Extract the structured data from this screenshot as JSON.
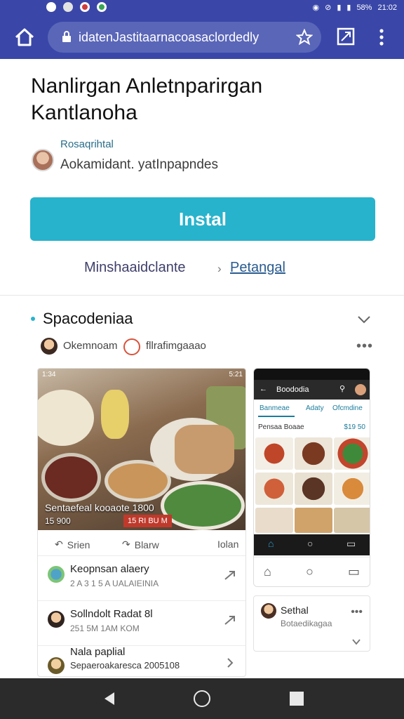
{
  "status_bar": {
    "battery": "58%",
    "time": "21:02"
  },
  "browser": {
    "url": "idatenJastitaarnacoasaclordedly"
  },
  "app": {
    "title": "Nanlirgan Anletnparirgan Kantlanoha",
    "developer_name": "Rosaqrihtal",
    "developer_desc": "Aokamidant. yatInpapndes",
    "install_label": "Instal",
    "more_label": "Minshaaidclante",
    "related_label": "Petangal"
  },
  "section": {
    "title": "Spacodeniaa",
    "author_name": "Okemnoam",
    "category_name": "fllrafimgaaao"
  },
  "left_card": {
    "status_time": "1:34",
    "status_right": "5:21",
    "caption": "Sentaefeal kooaote 1800",
    "price": "15 900",
    "tag": "15 RI BU M",
    "actions": {
      "share": "Srien",
      "save": "Blarw",
      "more": "Iolan"
    },
    "rows": [
      {
        "title": "Keopnsan alaery",
        "meta": "2 A 3  1 5 A      UALAIEINIA"
      },
      {
        "title": "Sollndolt Radat 8l",
        "meta": "251 5M          1AM KOM"
      },
      {
        "title": "Nala paplial",
        "meta": "Sepaeroakaresca 2005108"
      }
    ]
  },
  "phone": {
    "title": "Boododia",
    "tabs": [
      "Banmeae",
      "Adaty",
      "Ofcmdine"
    ],
    "subheader": "Pensaa Boaae",
    "subheader_price": "$19 50"
  },
  "right_card": {
    "title": "Sethal",
    "subtitle": "Botaedikagaa"
  },
  "colors": {
    "browser_toolbar": "#3a47a8",
    "install_button": "#27b3cc",
    "nav_bar": "#2b2b2b"
  }
}
